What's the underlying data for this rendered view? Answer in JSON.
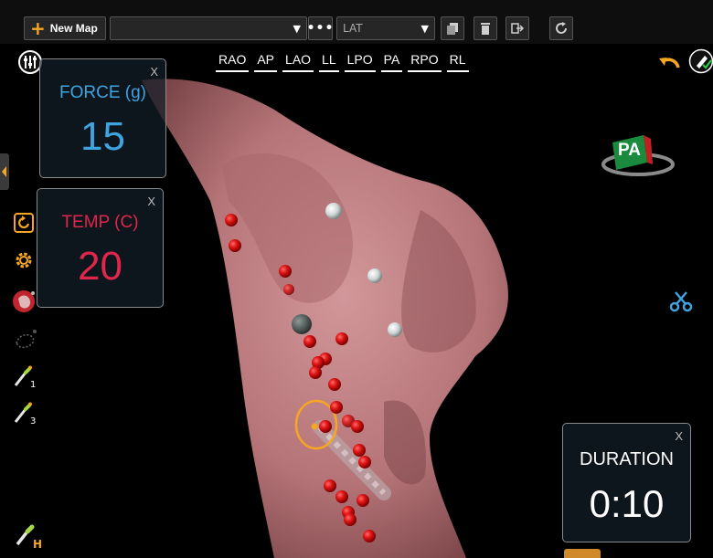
{
  "toolbar": {
    "new_map_label": "New Map",
    "map_selector_value": "",
    "more_label": "•••",
    "map_type_value": "LAT"
  },
  "view_tabs": [
    "RAO",
    "AP",
    "LAO",
    "LL",
    "LPO",
    "PA",
    "RPO",
    "RL"
  ],
  "orientation_badge": "PA",
  "force_panel": {
    "title": "FORCE (g)",
    "value": "15",
    "close": "X"
  },
  "temp_panel": {
    "title": "TEMP (C)",
    "value": "20",
    "close": "X"
  },
  "duration_panel": {
    "title": "DURATION",
    "value": "0:10",
    "close": "X"
  },
  "left_tools": {
    "catheter_1_sub": "1",
    "catheter_3_sub": "3",
    "catheter_h_sub": "H"
  },
  "colors": {
    "accent": "#f5a623",
    "force": "#3fa3e0",
    "temp": "#e0264a",
    "lesion": "#d41a1a",
    "tissue": "#c98a8e"
  }
}
